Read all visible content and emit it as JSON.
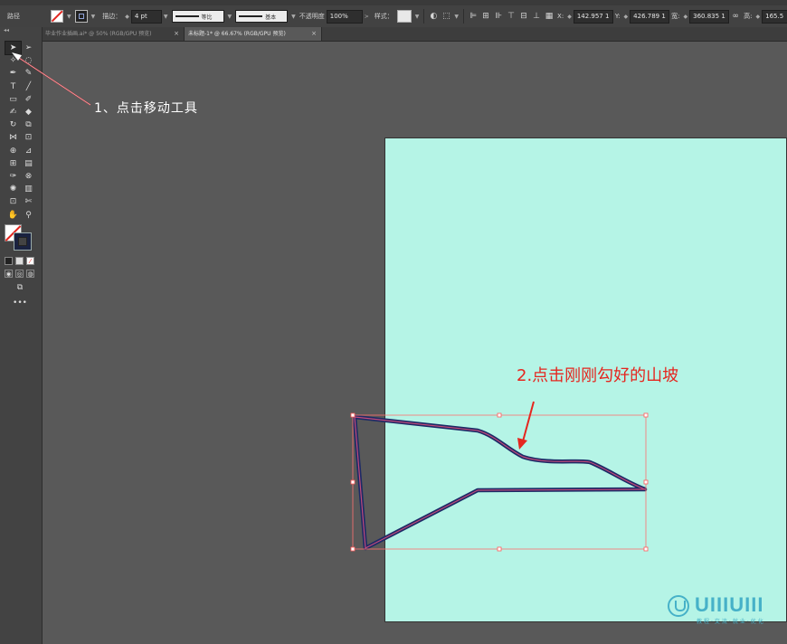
{
  "control_bar": {
    "object_type": "路径",
    "stroke_label": "描边：",
    "stroke_weight": "4 pt",
    "profile_label": "等比",
    "brush_label": "基本",
    "opacity_label": "不透明度",
    "opacity_value": "100%",
    "style_label": "样式：",
    "x_label": "X:",
    "x_value": "142.957 1",
    "y_label": "Y:",
    "y_value": "426.789 1",
    "w_label": "宽:",
    "w_value": "360.835 1",
    "h_label": "高:",
    "h_value": "165.5"
  },
  "tabs": [
    {
      "label": "毕业作业插画.ai* @ 50% (RGB/GPU 预览)",
      "active": false
    },
    {
      "label": "未标题-1* @ 66.67% (RGB/GPU 预览)",
      "active": true
    }
  ],
  "tab_close": "×",
  "annotations": {
    "step1": "1、点击移动工具",
    "step2": "2.点击刚刚勾好的山坡"
  },
  "watermark": {
    "text": "UIIIUIII",
    "sub": "教程·交流·就业·优化"
  },
  "colors": {
    "artboard": "#b5f4e6",
    "path_stroke": "#5b3a6e",
    "selection": "#ff6b6b",
    "annotation_red": "#e5261f"
  },
  "icons": {
    "selection_tool": "selection-arrow-icon",
    "fill_swatch": "fill-none-icon",
    "stroke_swatch": "stroke-icon"
  }
}
